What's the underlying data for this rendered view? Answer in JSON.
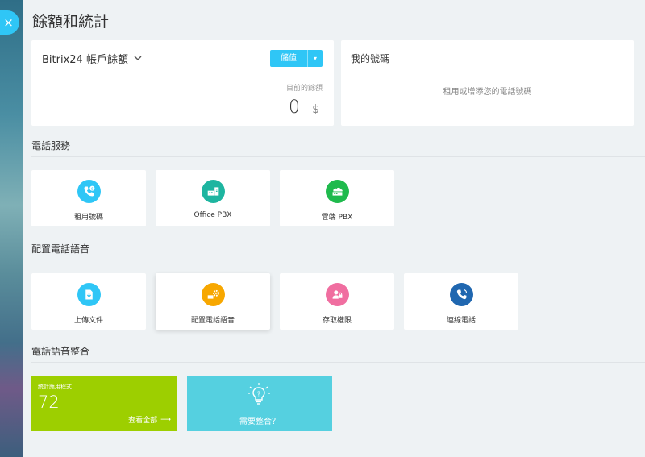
{
  "page": {
    "title": "餘額和統計",
    "close_icon": "×"
  },
  "balance": {
    "account_label": "Bitrix24 帳戶餘額",
    "topup_label": "儲值",
    "current_label": "目前的餘額",
    "amount": "0",
    "currency": "$"
  },
  "numbers": {
    "title": "我的號碼",
    "empty_text": "租用或增添您的電話號碼"
  },
  "sections": {
    "services": "電話服務",
    "configure": "配置電話語音",
    "integration": "電話語音整合"
  },
  "service_tiles": [
    {
      "label": "租用號碼",
      "icon": "phone-dollar-icon",
      "color": "#2fc6f6"
    },
    {
      "label": "Office PBX",
      "icon": "office-pbx-icon",
      "color": "#1eb5a0"
    },
    {
      "label": "雲端 PBX",
      "icon": "cloud-pbx-icon",
      "color": "#1fba4d"
    }
  ],
  "config_tiles": [
    {
      "label": "上傳文件",
      "icon": "upload-document-icon",
      "color": "#2fc6f6"
    },
    {
      "label": "配置電話語音",
      "icon": "settings-gear-icon",
      "color": "#f7a700"
    },
    {
      "label": "存取權限",
      "icon": "access-lock-icon",
      "color": "#f06ea0"
    },
    {
      "label": "連線電話",
      "icon": "connect-phone-icon",
      "color": "#2067b0"
    }
  ],
  "apps": {
    "caption": "統計應用程式",
    "count": "72",
    "view_all": "查看全部",
    "arrow": "⟶",
    "color": "#9dcf00"
  },
  "help": {
    "label": "需要整合？",
    "color": "#55d0e0"
  }
}
